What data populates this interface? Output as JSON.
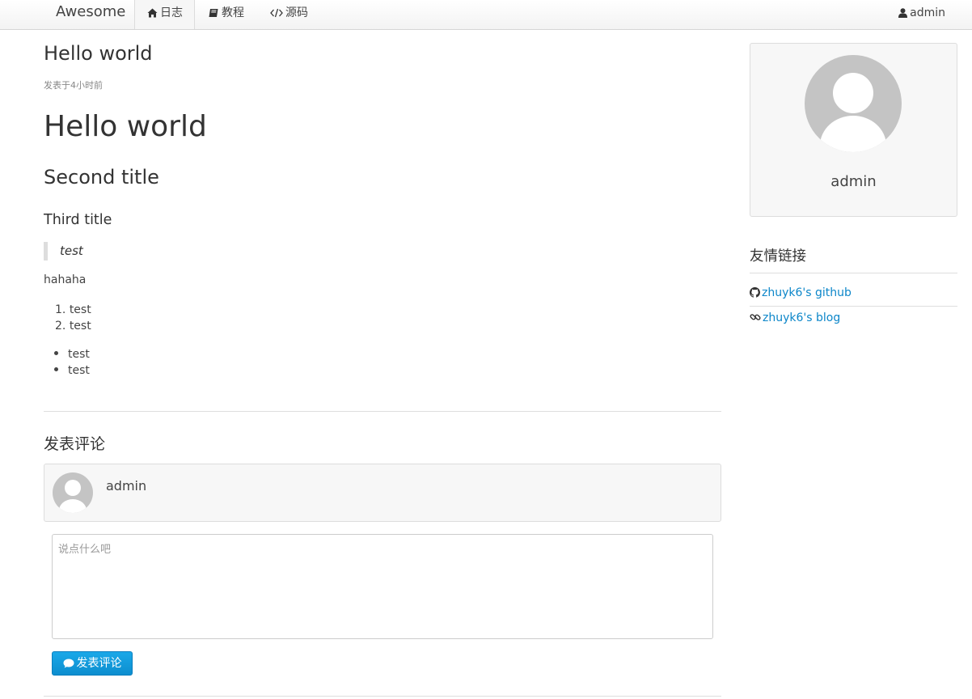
{
  "navbar": {
    "brand": "Awesome",
    "items": [
      {
        "label": "日志",
        "icon": "home-icon",
        "active": true
      },
      {
        "label": "教程",
        "icon": "book-icon",
        "active": false
      },
      {
        "label": "源码",
        "icon": "code-icon",
        "active": false
      }
    ],
    "user": {
      "label": "admin",
      "icon": "user-icon"
    }
  },
  "post": {
    "title": "Hello world",
    "meta": "发表于4小时前",
    "body": {
      "h1": "Hello world",
      "h2": "Second title",
      "h3": "Third title",
      "blockquote": "test",
      "paragraph": "hahaha",
      "ordered_list": [
        "test",
        "test"
      ],
      "unordered_list": [
        "test",
        "test"
      ]
    }
  },
  "comment_form": {
    "heading": "发表评论",
    "username": "admin",
    "textarea_placeholder": "说点什么吧",
    "submit_label": "发表评论",
    "submit_icon": "comment-icon"
  },
  "sidebar": {
    "profile_name": "admin",
    "links_heading": "友情链接",
    "links": [
      {
        "label": "zhuyk6's github",
        "icon": "github-icon"
      },
      {
        "label": "zhuyk6's blog",
        "icon": "link-icon"
      }
    ]
  },
  "colors": {
    "link": "#0c86c9",
    "button": "#1199dd",
    "avatar": "#c4c4c4",
    "panel": "#f7f7f7"
  }
}
